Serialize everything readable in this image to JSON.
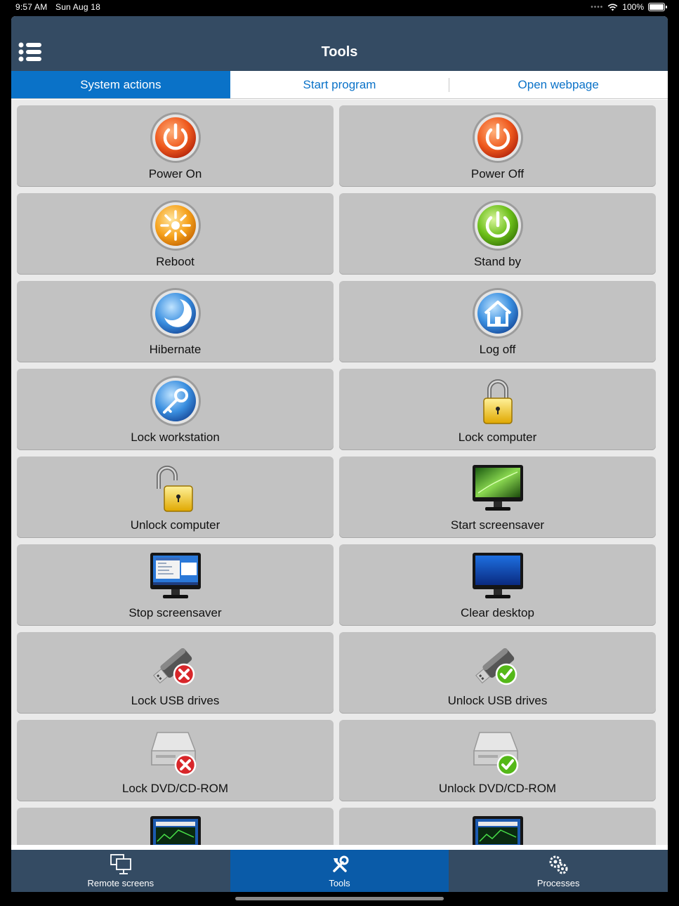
{
  "status_bar": {
    "time": "9:57 AM",
    "date": "Sun Aug 18",
    "battery": "100%"
  },
  "nav": {
    "title": "Tools",
    "menu_icon": "list-icon"
  },
  "segments": [
    "System actions",
    "Start program",
    "Open webpage"
  ],
  "tiles": [
    {
      "label": "Power On",
      "icon": "power-on-icon"
    },
    {
      "label": "Power Off",
      "icon": "power-off-icon"
    },
    {
      "label": "Reboot",
      "icon": "reboot-icon"
    },
    {
      "label": "Stand by",
      "icon": "standby-icon"
    },
    {
      "label": "Hibernate",
      "icon": "hibernate-moon-icon"
    },
    {
      "label": "Log off",
      "icon": "log-off-home-icon"
    },
    {
      "label": "Lock workstation",
      "icon": "key-icon"
    },
    {
      "label": "Lock computer",
      "icon": "padlock-closed-icon"
    },
    {
      "label": "Unlock computer",
      "icon": "padlock-open-icon"
    },
    {
      "label": "Start screensaver",
      "icon": "monitor-screensaver-icon"
    },
    {
      "label": "Stop screensaver",
      "icon": "monitor-desktop-icon"
    },
    {
      "label": "Clear desktop",
      "icon": "monitor-blank-icon"
    },
    {
      "label": "Lock USB drives",
      "icon": "usb-lock-icon"
    },
    {
      "label": "Unlock USB drives",
      "icon": "usb-unlock-icon"
    },
    {
      "label": "Lock DVD/CD-ROM",
      "icon": "dvd-lock-icon"
    },
    {
      "label": "Unlock DVD/CD-ROM",
      "icon": "dvd-unlock-icon"
    },
    {
      "label": "",
      "icon": "monitor-lock-icon"
    },
    {
      "label": "",
      "icon": "monitor-unlock-icon"
    }
  ],
  "tab_bar": [
    {
      "label": "Remote screens",
      "icon": "remote-screens-icon"
    },
    {
      "label": "Tools",
      "icon": "tools-icon"
    },
    {
      "label": "Processes",
      "icon": "gears-icon"
    }
  ],
  "colors": {
    "nav_bg": "#344b63",
    "accent_blue": "#0a72c8",
    "tab_active": "#0a5ba8",
    "tile_bg": "#c2c2c2",
    "power_red": "#e8501f",
    "standby_green": "#6cbf1a",
    "reboot_orange": "#f6a21c",
    "lock_red": "#d8262a",
    "unlock_green": "#54b818"
  }
}
